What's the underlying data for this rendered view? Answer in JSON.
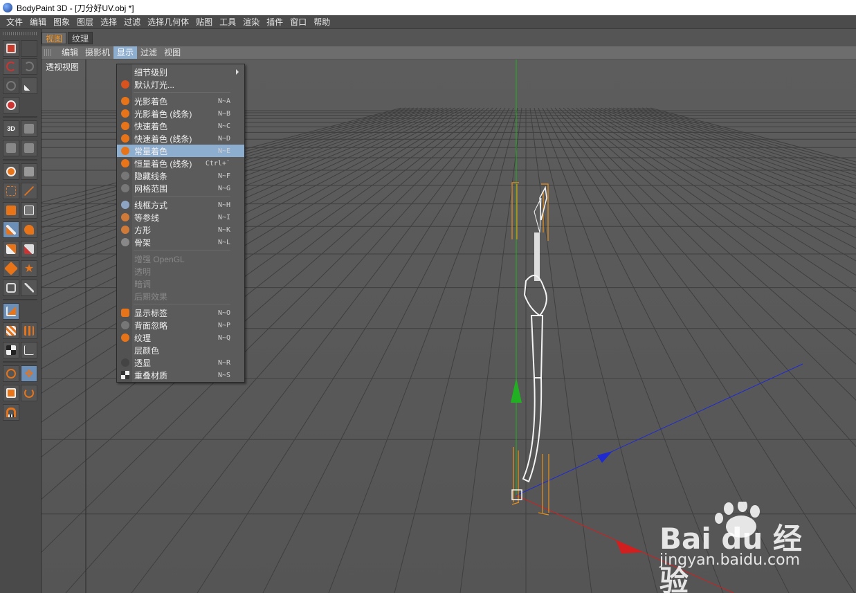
{
  "window": {
    "title": "BodyPaint 3D - [刀分好UV.obj *]"
  },
  "menubar": [
    "文件",
    "编辑",
    "图象",
    "图层",
    "选择",
    "过滤",
    "选择几何体",
    "贴图",
    "工具",
    "渲染",
    "插件",
    "窗口",
    "帮助"
  ],
  "view_tabs": [
    {
      "label": "视图",
      "active": true
    },
    {
      "label": "纹理",
      "active": false
    }
  ],
  "view_menubar": [
    "编辑",
    "摄影机",
    "显示",
    "过滤",
    "视图"
  ],
  "view_menubar_open": "显示",
  "viewport_label": "透视视图",
  "toolbar_icons": [
    "layer-icon",
    "undo-icon",
    "redo-icon",
    "transform-icon",
    "magic-icon",
    "sphere-icon",
    "3d-paint-icon",
    "brush-mode-icon",
    "projection-icon",
    "projection-alt-icon",
    "zoom-icon",
    "texture-view-icon",
    "rect-select-icon",
    "wand-select-icon",
    "move-icon",
    "polygon-icon",
    "paint-brush-icon",
    "smudge-icon",
    "eraser-icon",
    "color-picker-icon",
    "fill-bucket-icon",
    "star-icon",
    "clone-icon",
    "sharpen-icon",
    "uv-mode-icon",
    "uv-polygon-icon",
    "uv-points-icon",
    "checker-icon",
    "uv-edges-icon",
    "live-select-icon",
    "move-tool-icon",
    "scale-tool-icon",
    "rotate-tool-icon",
    "magnet-icon"
  ],
  "display_menu": {
    "items": [
      {
        "label": "细节级别",
        "shortcut": "",
        "submenu": true,
        "icon": "",
        "disabled": false
      },
      {
        "label": "默认灯光...",
        "shortcut": "",
        "submenu": false,
        "icon": "light-icon",
        "disabled": false
      },
      {
        "sep": true
      },
      {
        "label": "光影着色",
        "shortcut": "N~A",
        "icon": "gouraud-shading-icon",
        "disabled": false
      },
      {
        "label": "光影着色 (线条)",
        "shortcut": "N~B",
        "icon": "gouraud-lines-icon",
        "disabled": false
      },
      {
        "label": "快速着色",
        "shortcut": "N~C",
        "icon": "quick-shading-icon",
        "disabled": false
      },
      {
        "label": "快速着色 (线条)",
        "shortcut": "N~D",
        "icon": "quick-lines-icon",
        "disabled": false
      },
      {
        "label": "常量着色",
        "shortcut": "N~E",
        "icon": "constant-shading-icon",
        "disabled": false,
        "highlight": true
      },
      {
        "label": "恒量着色 (线条)",
        "shortcut": "Ctrl+`",
        "icon": "constant-lines-icon",
        "disabled": false
      },
      {
        "label": "隐藏线条",
        "shortcut": "N~F",
        "icon": "hidden-line-icon",
        "disabled": false
      },
      {
        "label": "网格范围",
        "shortcut": "N~G",
        "icon": "lines-icon",
        "disabled": false
      },
      {
        "sep": true
      },
      {
        "label": "线框方式",
        "shortcut": "N~H",
        "icon": "wireframe-icon",
        "disabled": false
      },
      {
        "label": "等参线",
        "shortcut": "N~I",
        "icon": "isoparm-icon",
        "disabled": false
      },
      {
        "label": "方形",
        "shortcut": "N~K",
        "icon": "box-icon",
        "disabled": false
      },
      {
        "label": "骨架",
        "shortcut": "N~L",
        "icon": "skeleton-icon",
        "disabled": false
      },
      {
        "sep": true
      },
      {
        "label": "增强 OpenGL",
        "shortcut": "",
        "icon": "",
        "disabled": true
      },
      {
        "label": "透明",
        "shortcut": "",
        "icon": "",
        "disabled": true
      },
      {
        "label": "暗调",
        "shortcut": "",
        "icon": "",
        "disabled": true
      },
      {
        "label": "后期效果",
        "shortcut": "",
        "icon": "",
        "disabled": true
      },
      {
        "sep": true
      },
      {
        "label": "显示标签",
        "shortcut": "N~O",
        "icon": "eye-icon",
        "disabled": false
      },
      {
        "label": "背面忽略",
        "shortcut": "N~P",
        "icon": "backface-icon",
        "disabled": false
      },
      {
        "label": "纹理",
        "shortcut": "N~Q",
        "icon": "texture-icon",
        "disabled": false
      },
      {
        "label": "层颜色",
        "shortcut": "",
        "icon": "",
        "disabled": false
      },
      {
        "label": "透显",
        "shortcut": "N~R",
        "icon": "xray-icon",
        "disabled": false
      },
      {
        "label": "重叠材质",
        "shortcut": "N~S",
        "icon": "tiles-icon",
        "disabled": false
      }
    ]
  },
  "colors": {
    "accent_orange": "#e8741a",
    "highlight_blue": "#8eaed0",
    "axis_x": "#d11f1f",
    "axis_y": "#21b021",
    "axis_z": "#1f2ad1"
  },
  "watermark": {
    "brand": "Bai du 经验",
    "url": "jingyan.baidu.com"
  }
}
